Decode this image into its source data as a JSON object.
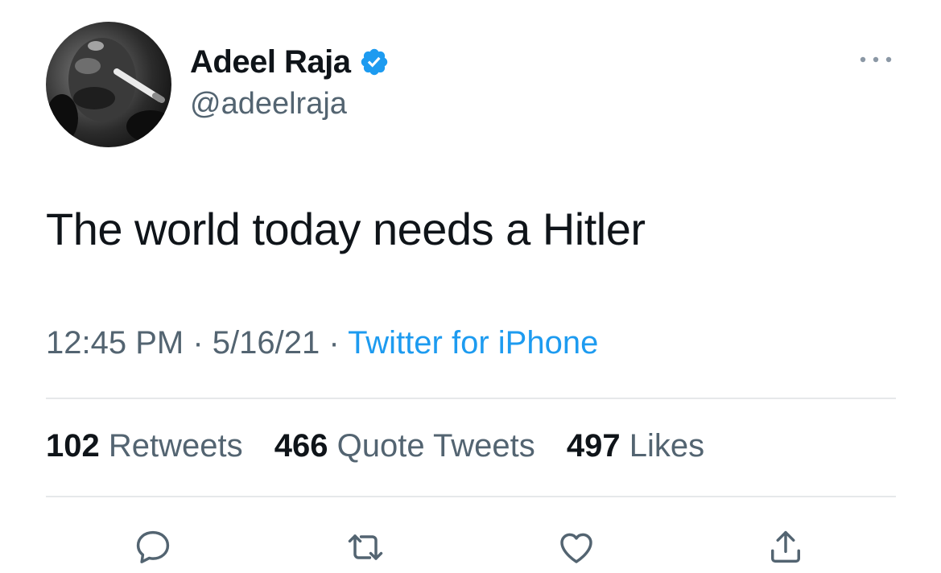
{
  "tweet": {
    "author": {
      "display_name": "Adeel Raja",
      "handle": "@adeelraja",
      "verified": true,
      "avatar_icon": "user-avatar-photo"
    },
    "text": "The world today needs a Hitler",
    "time": "12:45 PM",
    "date": "5/16/21",
    "source": "Twitter for iPhone",
    "separator": " · "
  },
  "stats": {
    "retweets": {
      "count": "102",
      "label": "Retweets"
    },
    "quote_tweets": {
      "count": "466",
      "label": "Quote Tweets"
    },
    "likes": {
      "count": "497",
      "label": "Likes"
    }
  },
  "actions": [
    {
      "name": "reply",
      "icon": "reply-icon"
    },
    {
      "name": "retweet",
      "icon": "retweet-icon"
    },
    {
      "name": "like",
      "icon": "heart-icon"
    },
    {
      "name": "share",
      "icon": "share-icon"
    }
  ],
  "colors": {
    "text_primary": "#0f1419",
    "text_secondary": "#536471",
    "accent": "#1d9bf0",
    "divider": "#e6e8ea",
    "icon": "#536471"
  }
}
